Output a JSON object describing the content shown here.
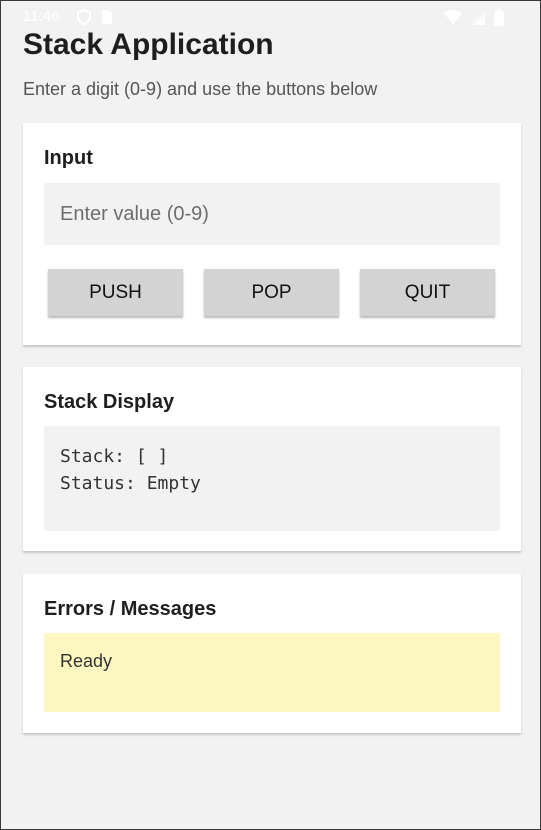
{
  "status_bar": {
    "time": "11:46"
  },
  "header": {
    "title": "Stack Application",
    "subtitle": "Enter a digit (0-9) and use the buttons below"
  },
  "input_card": {
    "heading": "Input",
    "field_value": "",
    "field_placeholder": "Enter value (0-9)",
    "push_label": "PUSH",
    "pop_label": "POP",
    "quit_label": "QUIT"
  },
  "stack_card": {
    "heading": "Stack Display",
    "stack_line": "Stack: [ ]",
    "status_line": "Status: Empty"
  },
  "errors_card": {
    "heading": "Errors / Messages",
    "message": "Ready"
  },
  "colors": {
    "background": "#f2f2f2",
    "card": "#ffffff",
    "button": "#d3d3d3",
    "message_bg": "#fdf8c2"
  }
}
